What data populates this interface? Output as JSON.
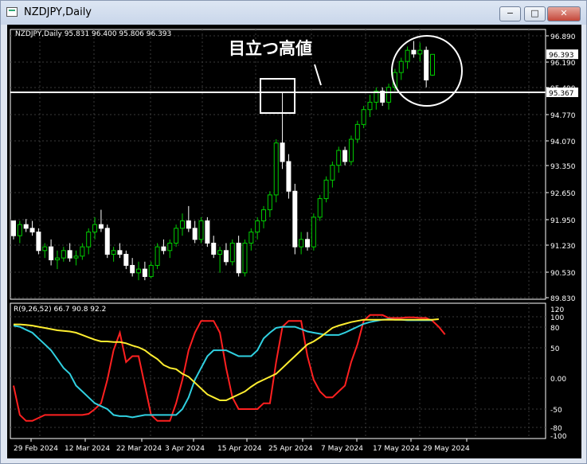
{
  "window": {
    "title": "NZDJPY,Daily",
    "minimize": "−",
    "maximize": "□",
    "close": "✕"
  },
  "chart": {
    "info": "NZDJPY,Daily  95.831 96.400 95.806 96.393",
    "annotation": "目立つ高値",
    "price_ticks": [
      "96.890",
      "96.190",
      "95.490",
      "94.770",
      "94.070",
      "93.350",
      "92.650",
      "91.950",
      "91.230",
      "90.530",
      "89.830"
    ],
    "current_price": "96.393",
    "line_price": "95.367",
    "date_labels": [
      "29 Feb 2024",
      "12 Mar 2024",
      "22 Mar 2024",
      "3 Apr 2024",
      "15 Apr 2024",
      "25 Apr 2024",
      "7 May 2024",
      "17 May 2024",
      "29 May 2024"
    ]
  },
  "indicator": {
    "label": "R(9,26,52) 66.7 90.8 92.2",
    "ticks": [
      "120",
      "100",
      "80",
      "50",
      "0.00",
      "-50",
      "-80",
      "-100"
    ]
  },
  "chart_data": {
    "type": "candlestick",
    "y_range": [
      89.83,
      96.89
    ],
    "horizontal_line": 95.367,
    "colors": {
      "up": "#00cc00",
      "down": "#ffffff",
      "line": "#ffffff",
      "grid": "#3a3a3a"
    },
    "candles": [
      [
        91.9,
        91.9,
        91.4,
        91.5
      ],
      [
        91.5,
        91.9,
        91.3,
        91.8
      ],
      [
        91.8,
        91.95,
        91.6,
        91.7
      ],
      [
        91.7,
        91.9,
        91.5,
        91.6
      ],
      [
        91.6,
        91.7,
        91.0,
        91.1
      ],
      [
        91.1,
        91.3,
        90.9,
        91.2
      ],
      [
        91.2,
        91.4,
        90.7,
        90.85
      ],
      [
        90.85,
        91.1,
        90.6,
        90.9
      ],
      [
        90.9,
        91.2,
        90.8,
        91.1
      ],
      [
        91.1,
        91.3,
        90.8,
        90.9
      ],
      [
        90.9,
        91.1,
        90.7,
        90.95
      ],
      [
        90.95,
        91.3,
        90.85,
        91.2
      ],
      [
        91.2,
        91.7,
        91.0,
        91.6
      ],
      [
        91.6,
        92.0,
        91.4,
        91.8
      ],
      [
        91.8,
        92.2,
        91.6,
        91.7
      ],
      [
        91.7,
        91.8,
        90.9,
        91.0
      ],
      [
        91.0,
        91.2,
        90.8,
        91.1
      ],
      [
        91.1,
        91.3,
        90.9,
        91.0
      ],
      [
        91.0,
        91.1,
        90.6,
        90.7
      ],
      [
        90.7,
        90.9,
        90.4,
        90.5
      ],
      [
        90.5,
        90.8,
        90.3,
        90.6
      ],
      [
        90.6,
        90.8,
        90.3,
        90.4
      ],
      [
        90.4,
        90.8,
        90.35,
        90.7
      ],
      [
        90.7,
        91.3,
        90.6,
        91.2
      ],
      [
        91.2,
        91.4,
        91.0,
        91.1
      ],
      [
        91.1,
        91.4,
        90.9,
        91.3
      ],
      [
        91.3,
        91.8,
        91.2,
        91.7
      ],
      [
        91.7,
        92.1,
        91.5,
        91.9
      ],
      [
        91.9,
        92.3,
        91.6,
        91.7
      ],
      [
        91.7,
        91.9,
        91.3,
        91.4
      ],
      [
        91.4,
        92.0,
        91.3,
        91.9
      ],
      [
        91.9,
        92.0,
        91.2,
        91.3
      ],
      [
        91.3,
        91.5,
        90.9,
        91.0
      ],
      [
        91.0,
        91.2,
        90.5,
        91.1
      ],
      [
        91.1,
        91.3,
        90.7,
        90.8
      ],
      [
        90.8,
        91.4,
        90.7,
        91.3
      ],
      [
        91.3,
        91.5,
        90.4,
        90.5
      ],
      [
        90.5,
        91.4,
        90.4,
        91.3
      ],
      [
        91.3,
        91.7,
        91.1,
        91.6
      ],
      [
        91.6,
        92.0,
        91.4,
        91.9
      ],
      [
        91.9,
        92.3,
        91.7,
        92.2
      ],
      [
        92.2,
        92.7,
        92.0,
        92.6
      ],
      [
        92.6,
        94.1,
        92.4,
        94.0
      ],
      [
        94.0,
        95.35,
        93.3,
        93.5
      ],
      [
        93.5,
        93.7,
        92.5,
        92.7
      ],
      [
        92.7,
        92.9,
        91.0,
        91.2
      ],
      [
        91.2,
        91.6,
        91.0,
        91.4
      ],
      [
        91.4,
        91.6,
        91.1,
        91.2
      ],
      [
        91.2,
        92.1,
        91.1,
        92.0
      ],
      [
        92.0,
        92.6,
        91.9,
        92.5
      ],
      [
        92.5,
        93.1,
        92.4,
        93.0
      ],
      [
        93.0,
        93.5,
        92.8,
        93.4
      ],
      [
        93.4,
        93.9,
        93.2,
        93.8
      ],
      [
        93.8,
        93.9,
        93.4,
        93.5
      ],
      [
        93.5,
        94.2,
        93.4,
        94.1
      ],
      [
        94.1,
        94.6,
        94.0,
        94.5
      ],
      [
        94.5,
        95.0,
        94.4,
        94.9
      ],
      [
        94.9,
        95.3,
        94.7,
        95.1
      ],
      [
        95.1,
        95.5,
        94.9,
        95.4
      ],
      [
        95.4,
        95.5,
        95.0,
        95.1
      ],
      [
        95.1,
        95.6,
        94.9,
        95.5
      ],
      [
        95.5,
        96.0,
        95.4,
        95.9
      ],
      [
        95.9,
        96.3,
        95.7,
        96.2
      ],
      [
        96.2,
        96.6,
        96.0,
        96.5
      ],
      [
        96.5,
        96.75,
        96.3,
        96.4
      ],
      [
        96.4,
        96.7,
        96.2,
        96.5
      ],
      [
        96.5,
        96.6,
        95.5,
        95.7
      ],
      [
        95.83,
        96.4,
        95.81,
        96.39
      ]
    ],
    "indicator": {
      "y_range": [
        -110,
        120
      ],
      "series": [
        {
          "color": "#ff2020",
          "values": [
            -20,
            -70,
            -80,
            -80,
            -75,
            -70,
            -70,
            -70,
            -70,
            -70,
            -70,
            -70,
            -68,
            -60,
            -50,
            -10,
            40,
            70,
            20,
            30,
            30,
            -20,
            -70,
            -80,
            -80,
            -80,
            -50,
            -10,
            40,
            70,
            90,
            90,
            90,
            70,
            10,
            -40,
            -60,
            -60,
            -60,
            -60,
            -50,
            -50,
            20,
            80,
            90,
            90,
            90,
            30,
            -10,
            -30,
            -40,
            -40,
            -30,
            -20,
            20,
            50,
            90,
            100,
            100,
            100,
            95,
            95,
            95,
            96,
            96,
            95,
            95,
            90,
            80,
            67
          ]
        },
        {
          "color": "#30d0e0",
          "values": [
            82,
            80,
            75,
            70,
            60,
            50,
            40,
            25,
            10,
            0,
            -20,
            -30,
            -40,
            -50,
            -55,
            -60,
            -70,
            -72,
            -72,
            -74,
            -72,
            -70,
            -70,
            -70,
            -70,
            -70,
            -70,
            -60,
            -40,
            -10,
            10,
            30,
            40,
            40,
            40,
            35,
            30,
            30,
            30,
            40,
            60,
            70,
            78,
            80,
            80,
            80,
            76,
            72,
            70,
            68,
            66,
            66,
            66,
            70,
            75,
            80,
            85,
            88,
            90,
            92,
            93,
            92,
            92,
            91,
            91,
            91,
            91,
            91
          ]
        },
        {
          "color": "#ffee30",
          "values": [
            84,
            84,
            83,
            82,
            80,
            78,
            76,
            74,
            73,
            72,
            70,
            66,
            62,
            58,
            55,
            55,
            54,
            54,
            52,
            48,
            45,
            40,
            32,
            25,
            15,
            10,
            8,
            0,
            -5,
            -15,
            -25,
            -35,
            -40,
            -45,
            -45,
            -40,
            -35,
            -30,
            -22,
            -15,
            -10,
            -5,
            0,
            10,
            20,
            30,
            40,
            50,
            55,
            62,
            70,
            78,
            82,
            85,
            88,
            90,
            92,
            92,
            92,
            92,
            92,
            92,
            92,
            92,
            92,
            92,
            92,
            92,
            93
          ]
        }
      ]
    }
  }
}
